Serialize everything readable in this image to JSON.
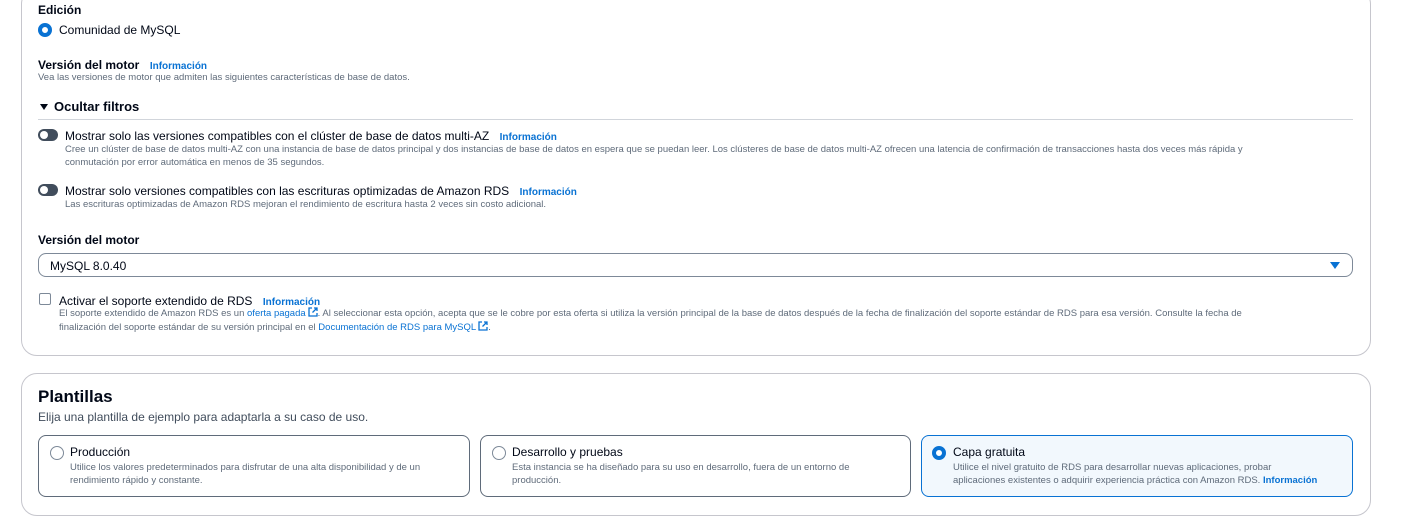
{
  "edition": {
    "label": "Edición",
    "option": "Comunidad de MySQL"
  },
  "engine_version_header": {
    "label": "Versión del motor",
    "info": "Información",
    "description": "Vea las versiones de motor que admiten las siguientes características de base de datos."
  },
  "filters": {
    "toggle_label": "Ocultar filtros",
    "multi_az": {
      "label": "Mostrar solo las versiones compatibles con el clúster de base de datos multi-AZ",
      "info": "Información",
      "description_line1": "Cree un clúster de base de datos multi-AZ con una instancia de base de datos principal y dos instancias de base de datos en espera que se puedan leer. Los clústeres de base de datos multi-AZ ofrecen una latencia de confirmación de transacciones hasta dos veces más rápida y",
      "description_line2": "conmutación por error automática en menos de 35 segundos."
    },
    "optimized_writes": {
      "label": "Mostrar solo versiones compatibles con las escrituras optimizadas de Amazon RDS",
      "info": "Información",
      "description": "Las escrituras optimizadas de Amazon RDS mejoran el rendimiento de escritura hasta 2 veces sin costo adicional."
    }
  },
  "engine_version_select": {
    "label": "Versión del motor",
    "value": "MySQL 8.0.40"
  },
  "extended_support": {
    "label": "Activar el soporte extendido de RDS",
    "info": "Información",
    "desc_prefix": "El soporte extendido de Amazon RDS es un",
    "desc_link1": "oferta pagada",
    "desc_middle": ". Al seleccionar esta opción, acepta que se le cobre por esta oferta si utiliza la versión principal de la base de datos después de la fecha de finalización del soporte estándar de RDS para esa versión. Consulte la fecha de",
    "desc_line2_prefix": "finalización del soporte estándar de su versión principal en el",
    "desc_link2": "Documentación de RDS para MySQL",
    "desc_suffix": "."
  },
  "templates": {
    "title": "Plantillas",
    "subtitle": "Elija una plantilla de ejemplo para adaptarla a su caso de uso.",
    "options": [
      {
        "title": "Producción",
        "desc_line1": "Utilice los valores predeterminados para disfrutar de una alta disponibilidad y de un",
        "desc_line2": "rendimiento rápido y constante.",
        "selected": false
      },
      {
        "title": "Desarrollo y pruebas",
        "desc_line1": "Esta instancia se ha diseñado para su uso en desarrollo, fuera de un entorno de",
        "desc_line2": "producción.",
        "selected": false
      },
      {
        "title": "Capa gratuita",
        "desc_line1": "Utilice el nivel gratuito de RDS para desarrollar nuevas aplicaciones, probar",
        "desc_line2": "aplicaciones existentes o adquirir experiencia práctica con Amazon RDS.",
        "info": "Información",
        "selected": true
      }
    ]
  },
  "colors": {
    "accent": "#0972d3",
    "text": "#000716",
    "muted": "#5f6b7a",
    "border": "#c6c6cd",
    "selected_bg": "#f2f8fd"
  },
  "icons": [
    "external-link-icon",
    "caret-down-icon",
    "triangle-down-icon"
  ]
}
